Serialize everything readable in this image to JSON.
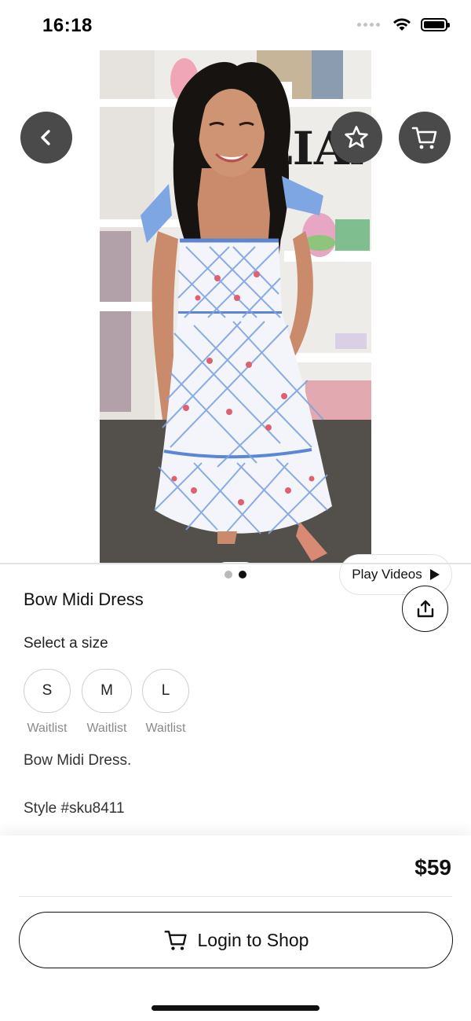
{
  "status": {
    "time": "16:18"
  },
  "hero": {
    "pager": {
      "total": 2,
      "active_index": 1
    },
    "play_videos_label": "Play Videos"
  },
  "icons": {
    "back": "chevron-left-icon",
    "favorite": "star-icon",
    "cart": "cart-icon",
    "share": "share-icon",
    "play": "play-icon"
  },
  "product": {
    "title": "Bow Midi Dress",
    "size_prompt": "Select a size",
    "sizes": [
      {
        "label": "S",
        "status": "Waitlist"
      },
      {
        "label": "M",
        "status": "Waitlist"
      },
      {
        "label": "L",
        "status": "Waitlist"
      }
    ],
    "description": "Bow Midi Dress.",
    "style": "Style #sku8411"
  },
  "footer": {
    "price": "$59",
    "login_label": "Login to Shop"
  },
  "colors": {
    "dress_print": "#5b86d6",
    "dress_ribbon": "#9ebbe8",
    "overlay_button": "#4a4a4a"
  }
}
